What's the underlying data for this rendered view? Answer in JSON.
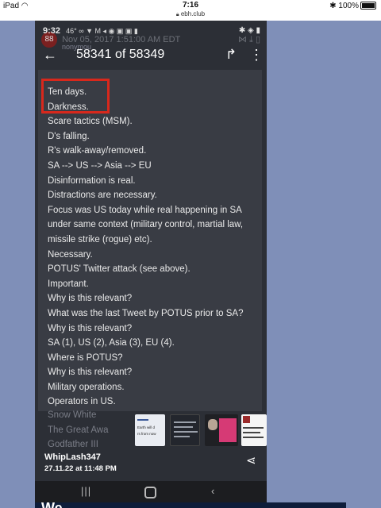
{
  "ipad": {
    "device": "iPad",
    "clock": "7:16",
    "url": "ebh.club",
    "battery": "100%"
  },
  "phone": {
    "time": "9:32",
    "temp": "46°",
    "notif_icons": "∞ ▼ M ◂ ◉ ▣ ▣ ▮",
    "sys_icons": "✱ ◈ ▮",
    "ghost_badge": "88",
    "ghost_date": "Nov 05, 2017 1:51:00 AM EDT",
    "anon_label": "nonymou",
    "counter": "58341 of 58349"
  },
  "post": {
    "lines": [
      "Ten days.",
      "Darkness.",
      "Scare tactics (MSM).",
      "D's falling.",
      "R's walk-away/removed.",
      "SA --> US --> Asia --> EU",
      "Disinformation is real.",
      "Distractions are necessary.",
      "Focus was US today while real happening in SA",
      "under same context (military control, martial law,",
      "missile strike (rogue) etc).",
      "Necessary.",
      "POTUS' Twitter attack (see above).",
      "Important.",
      "Why is this relevant?",
      "What was the last Tweet by POTUS prior to SA?",
      "Why is this relevant?",
      "SA (1), US (2), Asia (3), EU (4).",
      "Where is POTUS?",
      "Why is this relevant?",
      "Military operations.",
      "Operators in US."
    ],
    "below_lines": [
      "Snow White",
      "The Great Awa",
      "Godfather III"
    ]
  },
  "thumbs": {
    "t1_text": "Earth will d",
    "t1_text2": "rs from now"
  },
  "overlay": {
    "username": "WhipLash347",
    "date": "27.11.22 at 11:48 PM"
  },
  "banner": {
    "text": "We"
  },
  "colors": {
    "background": "#7f8fb8",
    "post_bg": "#393c44",
    "highlight": "#d8281c"
  }
}
